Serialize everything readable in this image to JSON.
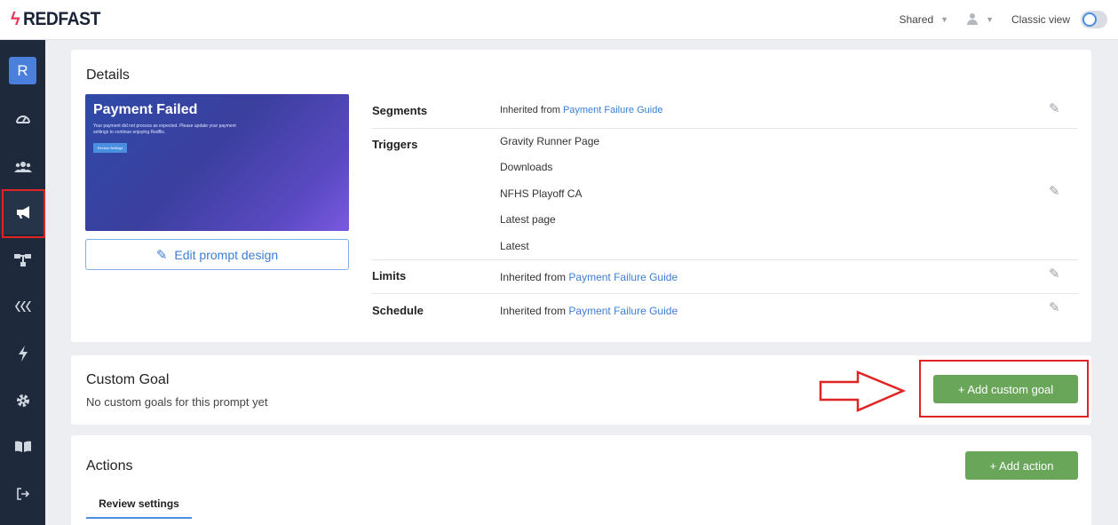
{
  "app": {
    "logo_text": "REDFAST",
    "brand_color": "#e8335a"
  },
  "topbar": {
    "shared_label": "Shared",
    "classic_view_label": "Classic view",
    "classic_view_on": false
  },
  "sidebar": {
    "avatar_letter": "R",
    "items": [
      {
        "icon": "dashboard-gauge-icon"
      },
      {
        "icon": "users-icon"
      },
      {
        "icon": "megaphone-icon",
        "active": true
      },
      {
        "icon": "flow-icon"
      },
      {
        "icon": "integrations-icon"
      },
      {
        "icon": "bolt-icon"
      },
      {
        "icon": "gear-icon"
      },
      {
        "icon": "book-icon"
      },
      {
        "icon": "logout-icon"
      }
    ]
  },
  "details": {
    "title": "Details",
    "preview": {
      "title": "Payment Failed",
      "body": "Your payment did not process as expected. Please update your payment settings to continue enjoying Redflix.",
      "button": "Review Settings"
    },
    "edit_design_label": "Edit prompt design",
    "segments": {
      "label": "Segments",
      "prefix": "Inherited from",
      "link": "Payment Failure Guide"
    },
    "triggers": {
      "label": "Triggers",
      "items": [
        "Gravity Runner Page",
        "Downloads",
        "NFHS Playoff CA",
        "Latest page",
        "Latest"
      ]
    },
    "limits": {
      "label": "Limits",
      "prefix": "Inherited from",
      "link": "Payment Failure Guide"
    },
    "schedule": {
      "label": "Schedule",
      "prefix": "Inherited from",
      "link": "Payment Failure Guide"
    }
  },
  "custom_goal": {
    "title": "Custom Goal",
    "empty_text": "No custom goals for this prompt yet",
    "add_button": "+ Add custom goal"
  },
  "actions": {
    "title": "Actions",
    "add_button": "+ Add action",
    "tabs": [
      "Review settings"
    ]
  }
}
